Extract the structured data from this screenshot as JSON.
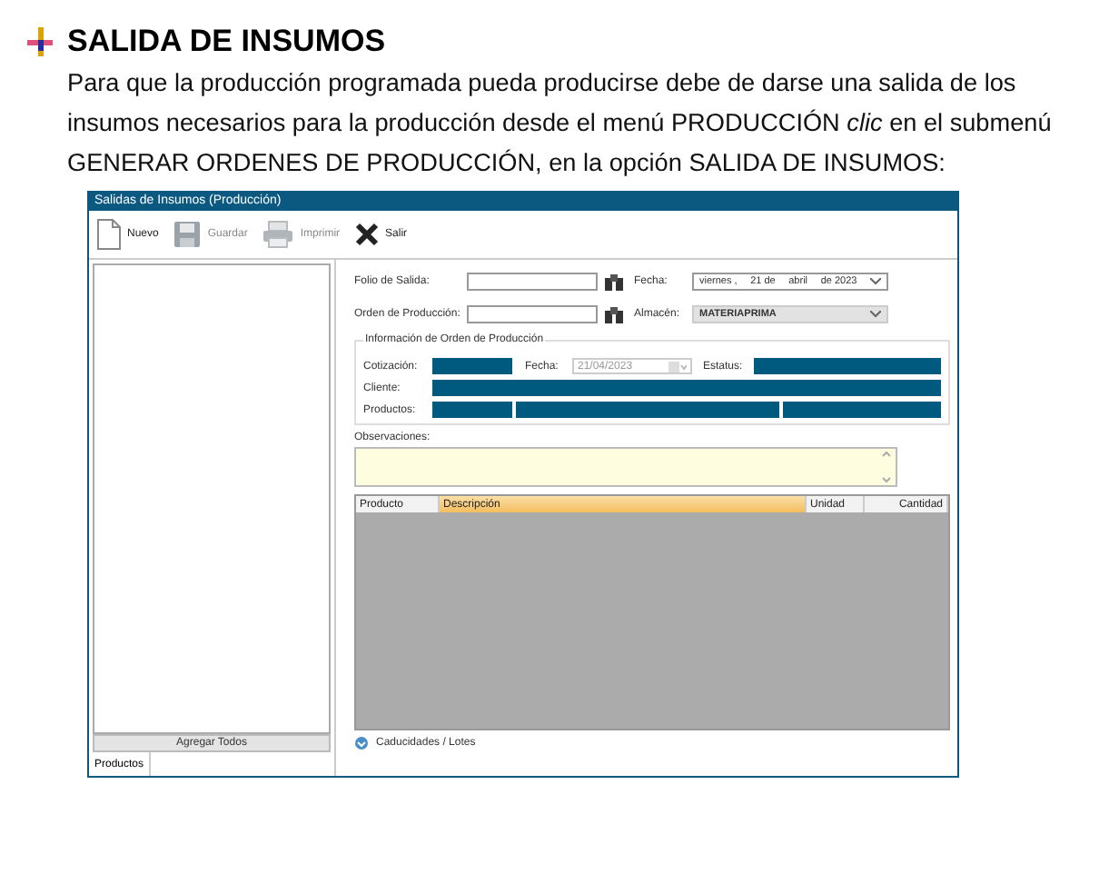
{
  "heading": "SALIDA DE INSUMOS",
  "paragraph": "Para que la producción programada pueda producirse debe de darse una salida de los insumos necesarios para la producción desde el menú PRODUCCIÓN *clic* en el submenú GENERAR ORDENES DE PRODUCCIÓN, en la opción SALIDA DE INSUMOS:",
  "window": {
    "title": "Salidas de Insumos (Producción)"
  },
  "toolbar": [
    {
      "label": "Nuevo",
      "kind": "new",
      "disabled": false
    },
    {
      "label": "Guardar",
      "kind": "save",
      "disabled": true
    },
    {
      "label": "Imprimir",
      "kind": "print",
      "disabled": true
    },
    {
      "label": "Salir",
      "kind": "exit",
      "disabled": false
    }
  ],
  "left_panel": {
    "button": "Agregar Todos",
    "tab": "Productos"
  },
  "form": {
    "folio_label": "Folio de Salida:",
    "fecha_label": "Fecha:",
    "fecha_parts": [
      "viernes ,",
      "21 de",
      "abril",
      "de 2023"
    ],
    "orden_label": "Orden de Producción:",
    "almacen_label": "Almacén:",
    "almacen_value": "MATERIAPRIMA"
  },
  "info": {
    "title": "Información de Orden de Producción",
    "cotizacion_label": "Cotización:",
    "fecha_label": "Fecha:",
    "fecha_value": "21/04/2023",
    "estatus_label": "Estatus:",
    "cliente_label": "Cliente:",
    "productos_label": "Productos:"
  },
  "observaciones_label": "Observaciones:",
  "table": {
    "columns": [
      {
        "label": "Producto",
        "selected": false
      },
      {
        "label": "Descripción",
        "selected": true
      },
      {
        "label": "Unidad",
        "selected": false
      },
      {
        "label": "Cantidad",
        "selected": false
      }
    ]
  },
  "expander": "Caducidades / Lotes"
}
